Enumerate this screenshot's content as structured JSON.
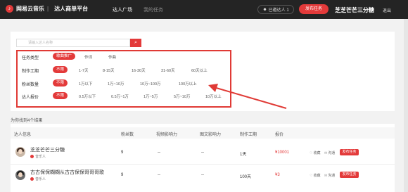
{
  "header": {
    "brand": "网易云音乐",
    "platform": "达人商单平台",
    "nav": [
      "达人广场",
      "我的任务"
    ],
    "invited": "已邀达人 1",
    "publish": "发布任务",
    "username": "芝芝芒芒三分糖",
    "logout": "退出"
  },
  "search": {
    "placeholder": "请输入达人名称"
  },
  "filters": [
    {
      "label": "任务类型",
      "options": [
        "歌曲推广",
        "作词",
        "作曲"
      ]
    },
    {
      "label": "制作工期",
      "options": [
        "不限",
        "1-7天",
        "8-15天",
        "16-30天",
        "31-60天",
        "60天以上"
      ]
    },
    {
      "label": "粉丝数量",
      "options": [
        "不限",
        "1万以下",
        "1万~10万",
        "10万~100万",
        "100万以上"
      ]
    },
    {
      "label": "达人报价",
      "options": [
        "不限",
        "0.5万以下",
        "0.5万~1万",
        "1万~5万",
        "5万~10万",
        "10万以上"
      ]
    }
  ],
  "result_count": "为你找到4个结果",
  "table": {
    "headers": [
      "达人信息",
      "粉丝数",
      "视频影响力",
      "图文影响力",
      "制作工期",
      "报价"
    ],
    "rows": [
      {
        "name": "芝芝芒芒三分糖",
        "tag": "音乐人",
        "fans": "9",
        "video": "--",
        "text": "--",
        "days": "1天",
        "price": "¥10001",
        "collect": "收藏",
        "chat": "沟通",
        "action": "发布任务"
      },
      {
        "name": "古古保保糊糊从古古保保哥哥哥歌",
        "tag": "音乐人",
        "fans": "9",
        "video": "--",
        "text": "--",
        "days": "100天",
        "price": "¥3",
        "collect": "收藏",
        "chat": "沟通",
        "action": "发布任务"
      }
    ]
  },
  "colors": {
    "accent": "#e33a3a",
    "topbar": "#242424",
    "annotation": "#e03a35"
  }
}
